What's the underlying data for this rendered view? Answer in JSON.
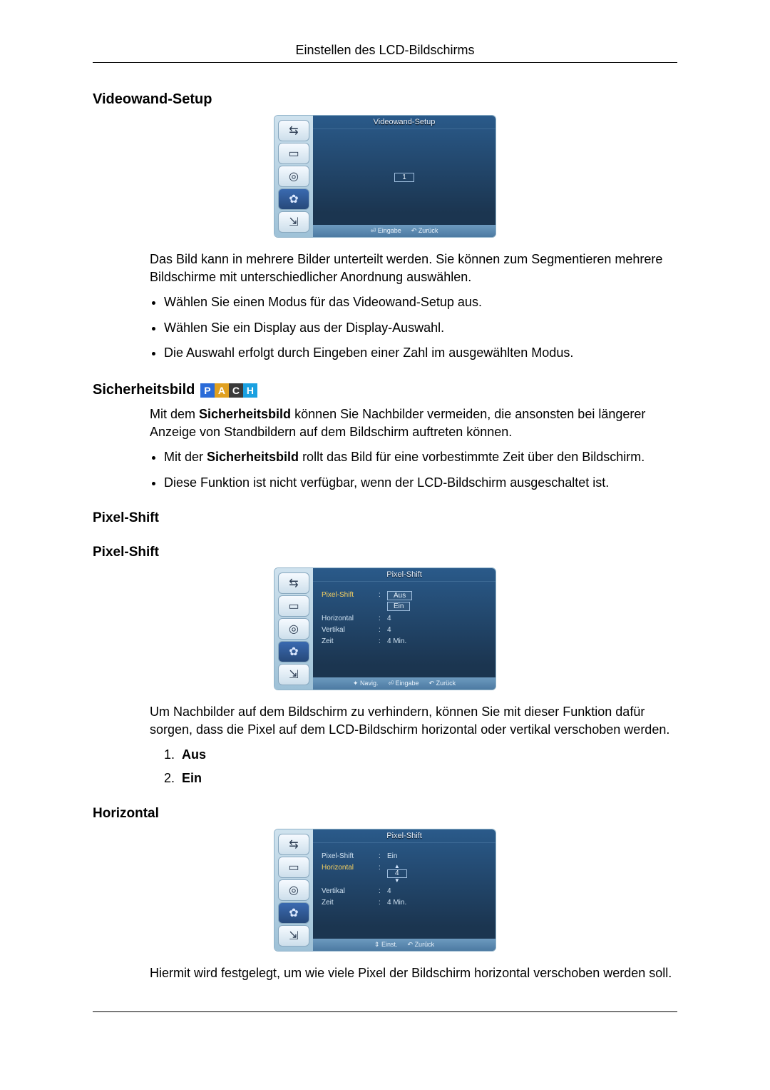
{
  "header": "Einstellen des LCD-Bildschirms",
  "sections": {
    "videowand": {
      "heading": "Videowand-Setup",
      "osd": {
        "title": "Videowand-Setup",
        "selected": "1",
        "footer": {
          "enter": "Eingabe",
          "back": "Zurück"
        }
      },
      "intro": "Das Bild kann in mehrere Bilder unterteilt werden. Sie können zum Segmentieren mehrere Bildschirme mit unterschiedlicher Anordnung auswählen.",
      "bullets": [
        "Wählen Sie einen Modus für das Videowand-Setup aus.",
        "Wählen Sie ein Display aus der Display-Auswahl.",
        "Die Auswahl erfolgt durch Eingeben einer Zahl im ausgewählten Modus."
      ]
    },
    "sicherheit": {
      "heading": "Sicherheitsbild",
      "badges": [
        "P",
        "A",
        "C",
        "H"
      ],
      "intro_pre": "Mit dem ",
      "intro_bold": "Sicherheitsbild",
      "intro_post": " können Sie Nachbilder vermeiden, die ansonsten bei längerer Anzeige von Standbildern auf dem Bildschirm auftreten können.",
      "bullets": [
        {
          "pre": "Mit der ",
          "bold": "Sicherheitsbild",
          "post": " rollt das Bild für eine vorbestimmte Zeit über den Bildschirm."
        },
        {
          "plain": "Diese Funktion ist nicht verfügbar, wenn der LCD-Bildschirm ausgeschaltet ist."
        }
      ]
    },
    "pixelshift": {
      "heading1": "Pixel-Shift",
      "heading2": "Pixel-Shift",
      "osd": {
        "title": "Pixel-Shift",
        "rows": {
          "pixelshift": {
            "label": "Pixel-Shift",
            "options": [
              "Aus",
              "Ein"
            ]
          },
          "horizontal": {
            "label": "Horizontal",
            "value": "4"
          },
          "vertikal": {
            "label": "Vertikal",
            "value": "4"
          },
          "zeit": {
            "label": "Zeit",
            "value": "4 Min."
          }
        },
        "footer": {
          "nav": "Navig.",
          "enter": "Eingabe",
          "back": "Zurück"
        }
      },
      "intro": "Um Nachbilder auf dem Bildschirm zu verhindern, können Sie mit dieser Funktion dafür sorgen, dass die Pixel auf dem LCD-Bildschirm horizontal oder vertikal verschoben werden.",
      "list": [
        {
          "n": "1.",
          "label": "Aus"
        },
        {
          "n": "2.",
          "label": "Ein"
        }
      ]
    },
    "horizontal": {
      "heading": "Horizontal",
      "osd": {
        "title": "Pixel-Shift",
        "rows": {
          "pixelshift": {
            "label": "Pixel-Shift",
            "value": "Ein"
          },
          "horizontal": {
            "label": "Horizontal",
            "value": "4"
          },
          "vertikal": {
            "label": "Vertikal",
            "value": "4"
          },
          "zeit": {
            "label": "Zeit",
            "value": "4 Min."
          }
        },
        "footer": {
          "adjust": "Einst.",
          "back": "Zurück"
        }
      },
      "text": "Hiermit wird festgelegt, um wie viele Pixel der Bildschirm horizontal verschoben werden soll."
    }
  },
  "icons": {
    "side1": "⇆",
    "side2": "▭",
    "side3": "◎",
    "side4": "✿",
    "side5": "⇲",
    "enter": "⏎",
    "back": "↶",
    "nav": "✦",
    "updown": "⇕"
  }
}
